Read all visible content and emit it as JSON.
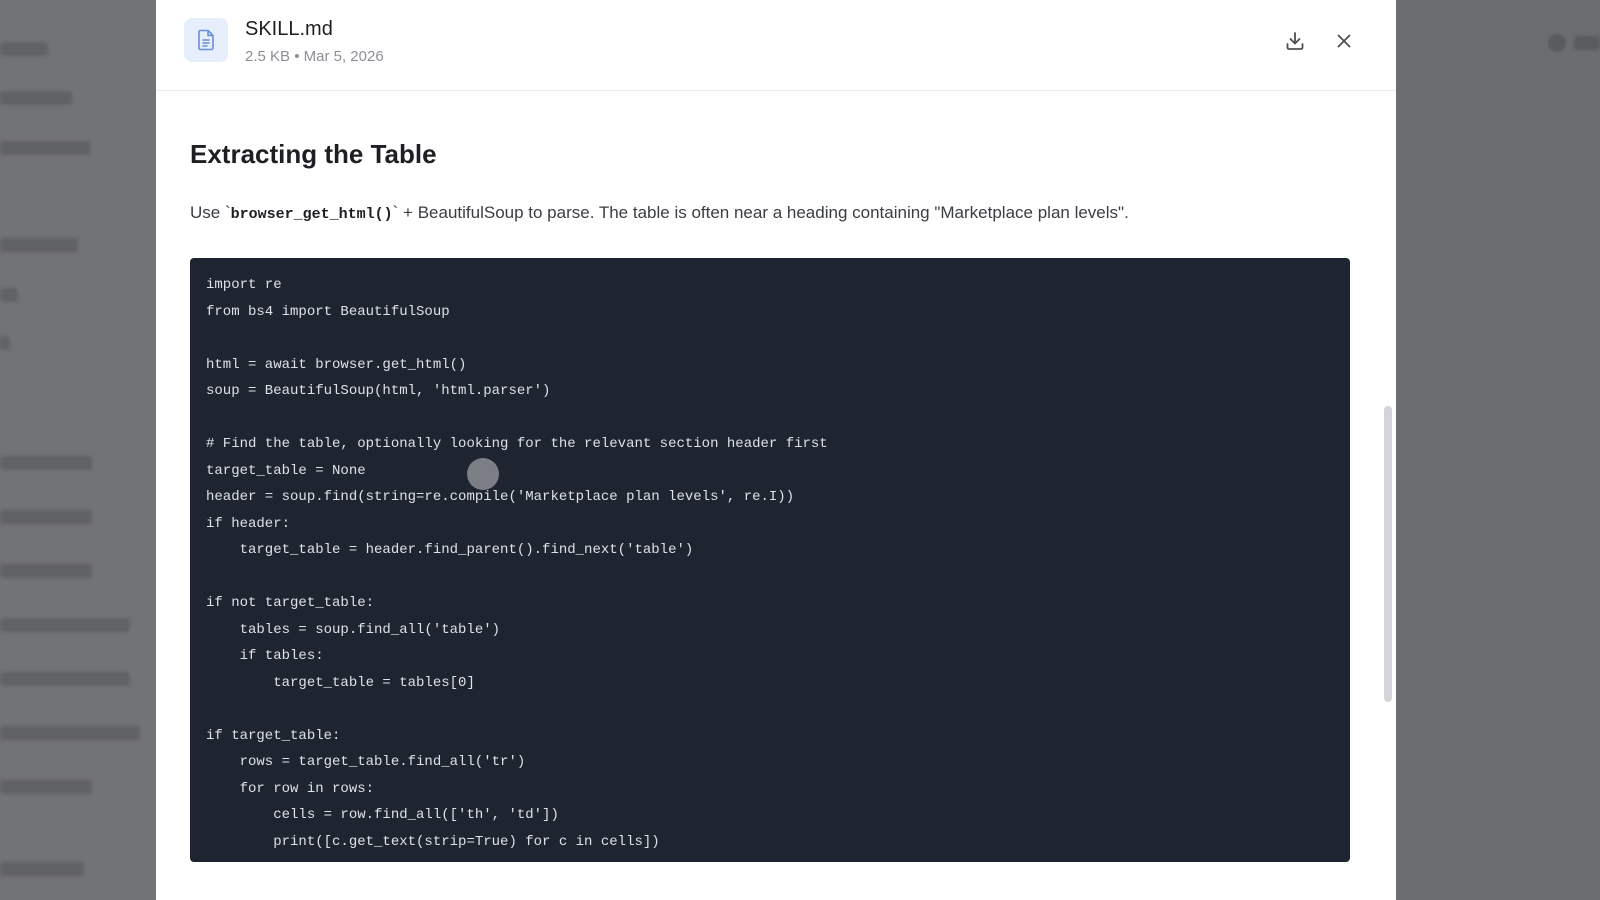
{
  "file": {
    "name": "SKILL.md",
    "meta": "2.5 KB • Mar 5, 2026",
    "icon": "file-icon"
  },
  "header": {
    "download_icon": "download-icon",
    "close_icon": "close-icon"
  },
  "doc": {
    "heading": "Extracting the Table",
    "para_prefix": "Use `",
    "para_code": "browser_get_html()",
    "para_suffix": "` + BeautifulSoup to parse. The table is often near a heading containing \"Marketplace plan levels\"."
  },
  "code": {
    "language": "python",
    "text": "import re\nfrom bs4 import BeautifulSoup\n\nhtml = await browser.get_html()\nsoup = BeautifulSoup(html, 'html.parser')\n\n# Find the table, optionally looking for the relevant section header first\ntarget_table = None\nheader = soup.find(string=re.compile('Marketplace plan levels', re.I))\nif header:\n    target_table = header.find_parent().find_next('table')\n\nif not target_table:\n    tables = soup.find_all('table')\n    if tables:\n        target_table = tables[0]\n\nif target_table:\n    rows = target_table.find_all('tr')\n    for row in rows:\n        cells = row.find_all(['th', 'td'])\n        print([c.get_text(strip=True) for c in cells])"
  },
  "colors": {
    "code_bg": "#1f2530",
    "code_fg": "#dde1e8",
    "accent": "#6b8fd6",
    "overlay": "#6f7072"
  }
}
